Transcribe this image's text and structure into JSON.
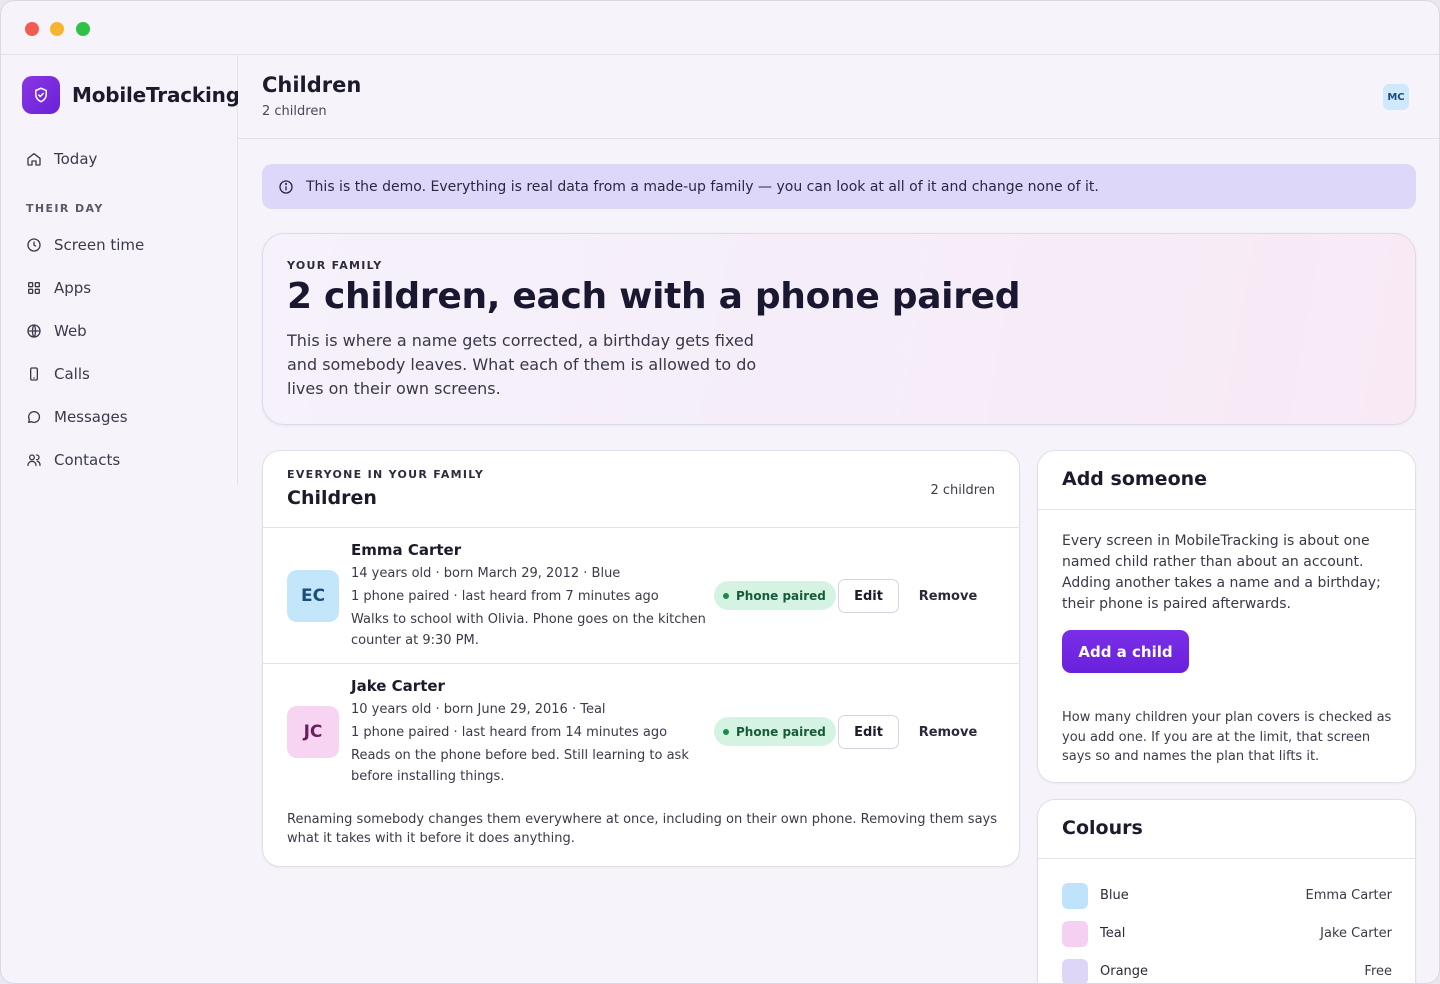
{
  "app": {
    "name": "MobileTracking"
  },
  "sidebar": {
    "today": "Today",
    "section": "THEIR DAY",
    "items": [
      {
        "label": "Screen time",
        "icon": "clock-icon"
      },
      {
        "label": "Apps",
        "icon": "grid-icon"
      },
      {
        "label": "Web",
        "icon": "globe-icon"
      },
      {
        "label": "Calls",
        "icon": "phone-icon"
      },
      {
        "label": "Messages",
        "icon": "chat-icon"
      },
      {
        "label": "Contacts",
        "icon": "people-icon"
      }
    ]
  },
  "header": {
    "title": "Children",
    "subtitle": "2 children",
    "user_initials": "MC"
  },
  "banner": {
    "text": "This is the demo. Everything is real data from a made-up family — you can look at all of it and change none of it."
  },
  "hero": {
    "eyebrow": "YOUR FAMILY",
    "title": "2 children, each with a phone paired",
    "body": "This is where a name gets corrected, a birthday gets fixed and somebody leaves. What each of them is allowed to do lives on their own screens."
  },
  "children_card": {
    "eyebrow": "EVERYONE IN YOUR FAMILY",
    "title": "Children",
    "count": "2 children",
    "children": [
      {
        "initials": "EC",
        "name": "Emma Carter",
        "line1": "14 years old · born March 29, 2012 · Blue",
        "line2": "1 phone paired · last heard from 7 minutes ago",
        "note": "Walks to school with Olivia. Phone goes on the kitchen counter at 9:30 PM.",
        "badge": "Phone paired",
        "edit": "Edit",
        "remove": "Remove",
        "avatar_bg": "#c4e6fb",
        "avatar_fg": "#1b4f7a"
      },
      {
        "initials": "JC",
        "name": "Jake Carter",
        "line1": "10 years old · born June 29, 2016 · Teal",
        "line2": "1 phone paired · last heard from 14 minutes ago",
        "note": "Reads on the phone before bed. Still learning to ask before installing things.",
        "badge": "Phone paired",
        "edit": "Edit",
        "remove": "Remove",
        "avatar_bg": "#f7d4f1",
        "avatar_fg": "#6a1e5c"
      }
    ],
    "footnote": "Renaming somebody changes them everywhere at once, including on their own phone. Removing them says what it takes with it before it does anything."
  },
  "add_card": {
    "title": "Add someone",
    "body": "Every screen in MobileTracking is about one named child rather than about an account. Adding another takes a name and a birthday; their phone is paired afterwards.",
    "button": "Add a child",
    "footnote": "How many children your plan covers is checked as you add one. If you are at the limit, that screen says so and names the plan that lifts it."
  },
  "colours_card": {
    "title": "Colours",
    "rows": [
      {
        "name": "Blue",
        "owner": "Emma Carter",
        "color": "#bfe3fb"
      },
      {
        "name": "Teal",
        "owner": "Jake Carter",
        "color": "#f6d0f2"
      },
      {
        "name": "Orange",
        "owner": "Free",
        "color": "#ddd6f6"
      }
    ]
  }
}
